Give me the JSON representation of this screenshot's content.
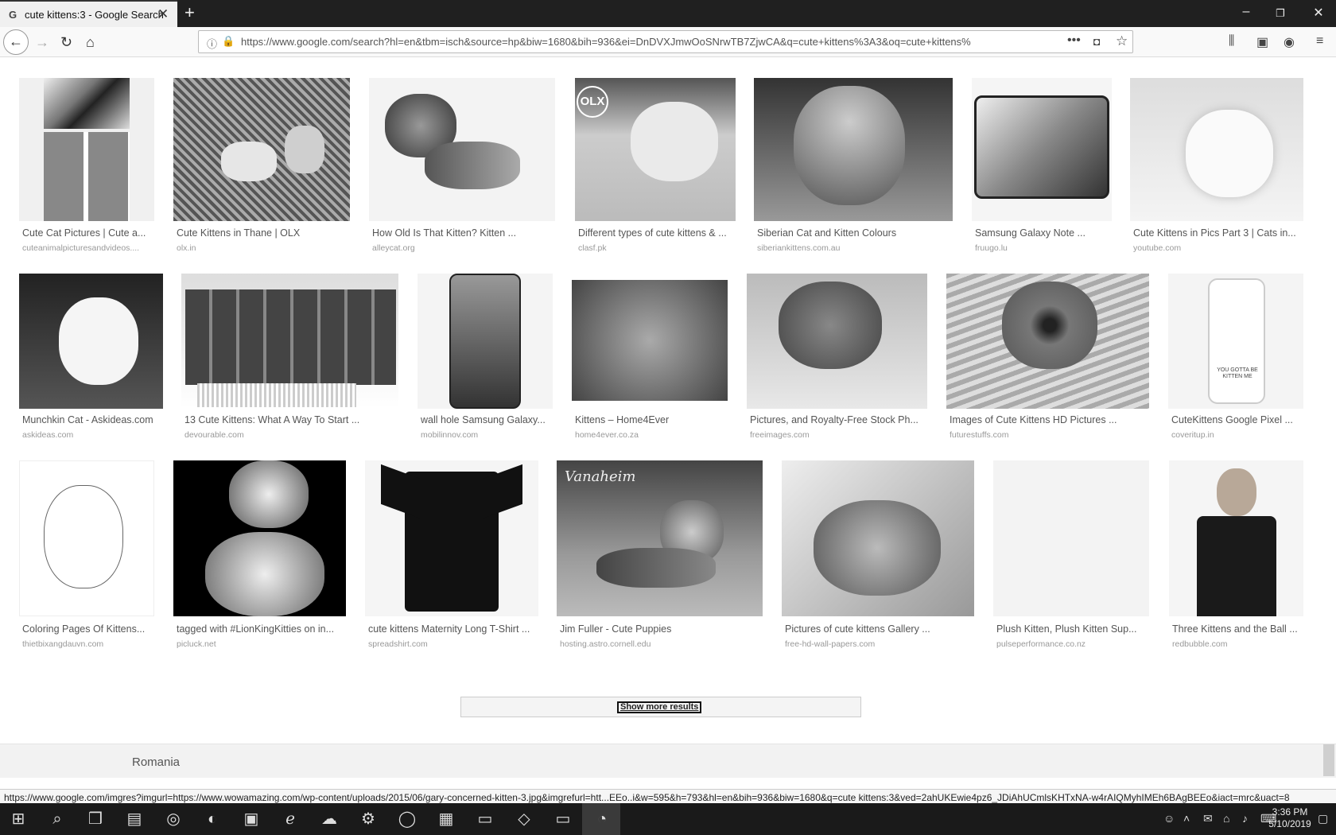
{
  "browser": {
    "tab_title": "cute kittens:3 - Google Search",
    "tab_favicon": "G",
    "url": "https://www.google.com/search?hl=en&tbm=isch&source=hp&biw=1680&bih=936&ei=DnDVXJmwOoSNrwTB7ZjwCA&q=cute+kittens%3A3&oq=cute+kittens%"
  },
  "results": [
    {
      "caption": "Cute Cat Pictures | Cute a...",
      "source": "cuteanimalpicturesandvideos...."
    },
    {
      "caption": "Cute Kittens in Thane | OLX",
      "source": "olx.in"
    },
    {
      "caption": "How Old Is That Kitten? Kitten ...",
      "source": "alleycat.org"
    },
    {
      "caption": "Different types of cute kittens & ...",
      "source": "clasf.pk",
      "overlay_text": "OLX"
    },
    {
      "caption": "Siberian Cat and Kitten Colours",
      "source": "siberiankittens.com.au"
    },
    {
      "caption": "Samsung Galaxy Note ...",
      "source": "fruugo.lu"
    },
    {
      "caption": "Cute Kittens in Pics Part 3 | Cats in...",
      "source": "youtube.com"
    },
    {
      "caption": "Munchkin Cat - Askideas.com",
      "source": "askideas.com"
    },
    {
      "caption": "13 Cute Kittens: What A Way To Start ...",
      "source": "devourable.com"
    },
    {
      "caption": "wall hole Samsung Galaxy...",
      "source": "mobilinnov.com"
    },
    {
      "caption": "Kittens – Home4Ever",
      "source": "home4ever.co.za"
    },
    {
      "caption": "Pictures, and Royalty-Free Stock Ph...",
      "source": "freeimages.com"
    },
    {
      "caption": "Images of Cute Kittens HD Pictures ...",
      "source": "futurestuffs.com"
    },
    {
      "caption": "CuteKittens Google Pixel ...",
      "source": "coveritup.in",
      "overlay_text": "YOU GOTTA BE KITTEN ME"
    },
    {
      "caption": "Coloring Pages Of Kittens...",
      "source": "thietbixangdauvn.com"
    },
    {
      "caption": "tagged with #LionKingKitties on in...",
      "source": "picluck.net"
    },
    {
      "caption": "cute kittens Maternity Long T-Shirt ...",
      "source": "spreadshirt.com"
    },
    {
      "caption": "Jim Fuller - Cute Puppies",
      "source": "hosting.astro.cornell.edu",
      "overlay_text": "Vanaheim"
    },
    {
      "caption": "Pictures of cute kittens Gallery ...",
      "source": "free-hd-wall-papers.com"
    },
    {
      "caption": "Plush Kitten, Plush Kitten Sup...",
      "source": "pulseperformance.co.nz"
    },
    {
      "caption": "Three Kittens and the Ball ...",
      "source": "redbubble.com"
    }
  ],
  "show_more_label": "Show more results",
  "footer_region": "Romania",
  "status_url": "https://www.google.com/imgres?imgurl=https://www.wowamazing.com/wp-content/uploads/2015/06/gary-concerned-kitten-3.jpg&imgrefurl=htt...EEo..i&w=595&h=793&hl=en&bih=936&biw=1680&q=cute kittens:3&ved=2ahUKEwie4pz6_JDiAhUCmlsKHTxNA-w4rAIQMyhIMEh6BAgBEEo&iact=mrc&uact=8",
  "clock": {
    "time": "3:36 PM",
    "date": "5/10/2019"
  }
}
